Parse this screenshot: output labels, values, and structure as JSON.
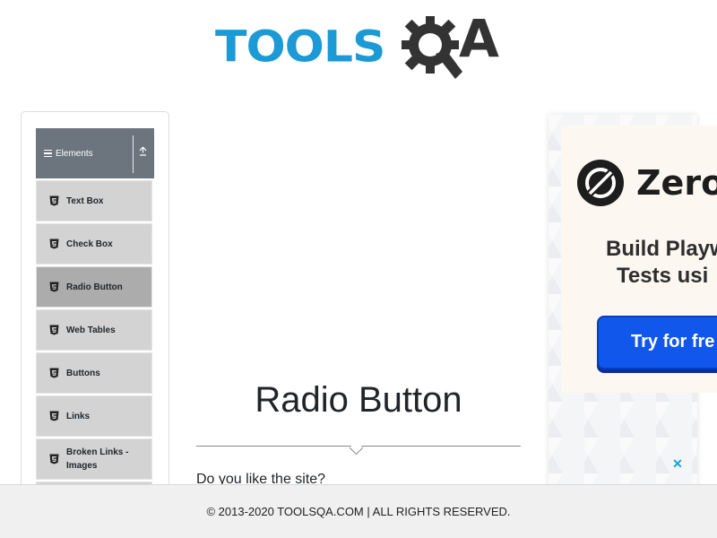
{
  "header": {
    "logo_text": "TOOLS",
    "logo_suffix": "A",
    "logo_brand": "TOOLSQA",
    "brand_blue": "#1b9ad6",
    "brand_dark": "#333333"
  },
  "sidebar": {
    "group_title": "Elements",
    "group_icon": "hamburger-icon",
    "collapse_icon": "arrow-up-icon",
    "items": [
      {
        "label": "Text Box",
        "icon": "html5-icon",
        "active": false
      },
      {
        "label": "Check Box",
        "icon": "html5-icon",
        "active": false
      },
      {
        "label": "Radio Button",
        "icon": "html5-icon",
        "active": true
      },
      {
        "label": "Web Tables",
        "icon": "html5-icon",
        "active": false
      },
      {
        "label": "Buttons",
        "icon": "html5-icon",
        "active": false
      },
      {
        "label": "Links",
        "icon": "html5-icon",
        "active": false
      },
      {
        "label": "Broken Links - Images",
        "icon": "html5-icon",
        "active": false
      }
    ],
    "colors": {
      "header": "#6c757d",
      "item": "#d3d3d3",
      "active": "#acacac"
    }
  },
  "main": {
    "title": "Radio Button",
    "question": "Do you like the site?"
  },
  "ad": {
    "brand": "Zero",
    "line1": "Build Playw",
    "line2": "Tests usi",
    "cta": "Try for fre",
    "close_icon": "close-icon",
    "close_glyph": "✕",
    "cta_color": "#1157ec"
  },
  "footer": {
    "text": "© 2013-2020 TOOLSQA.COM | ALL RIGHTS RESERVED."
  }
}
